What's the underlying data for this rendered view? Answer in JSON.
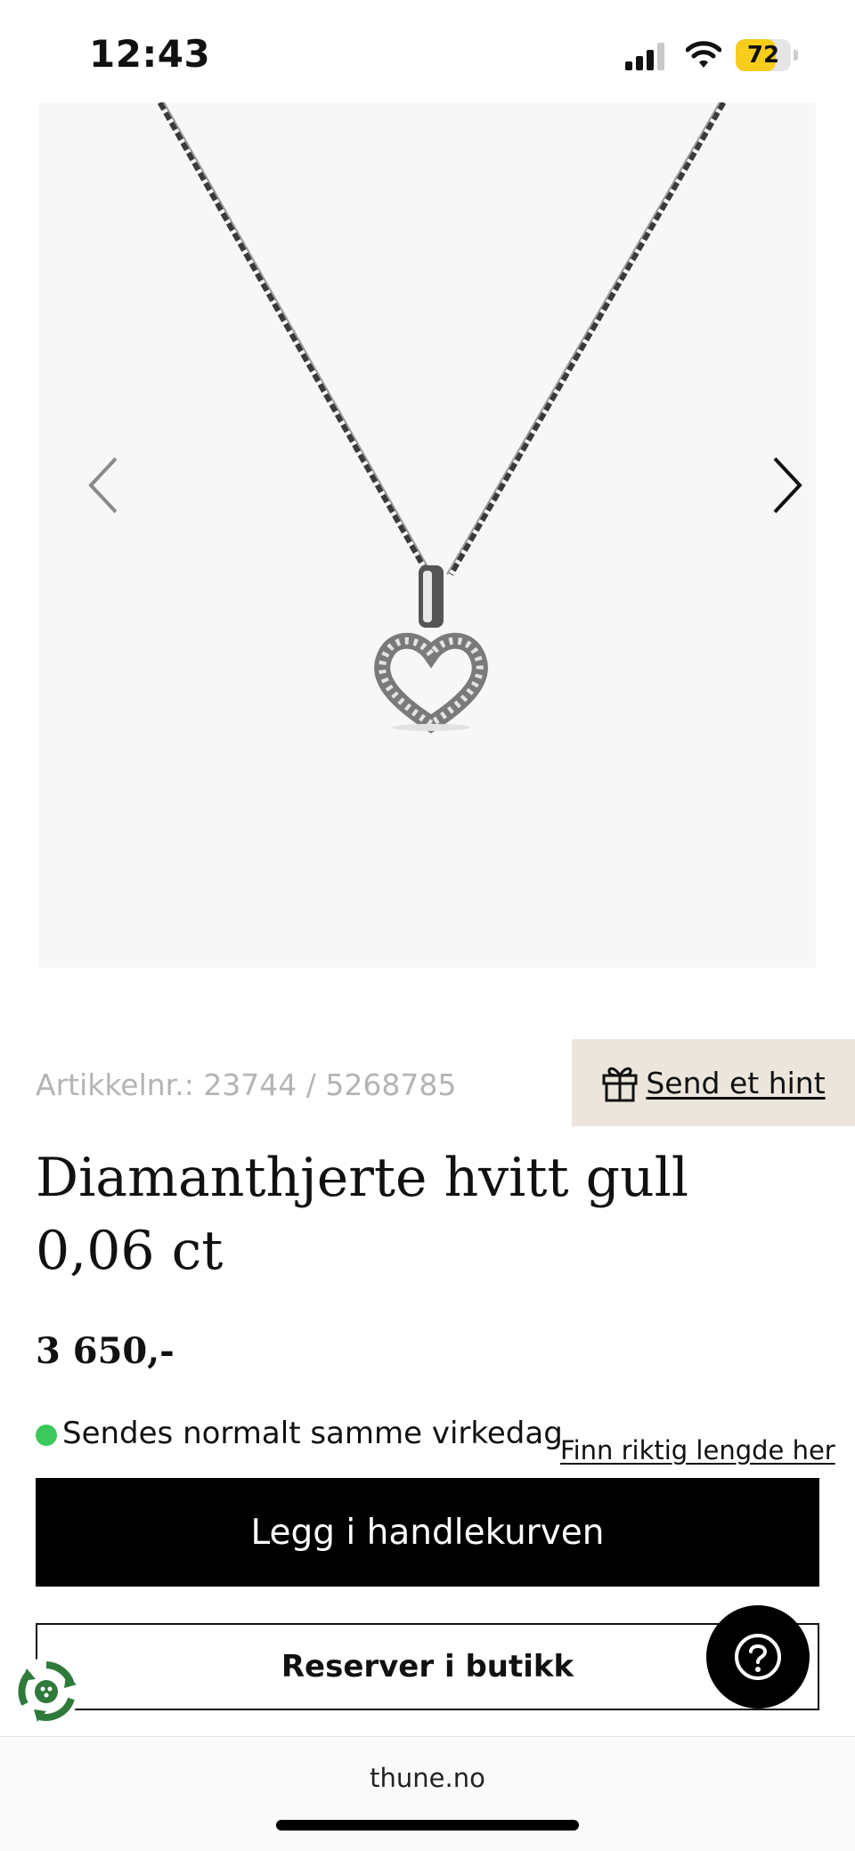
{
  "status_bar": {
    "time": "12:43",
    "battery_level": "72",
    "battery_fraction": 0.72,
    "icons": [
      "cellular-signal-icon",
      "wifi-icon",
      "battery-icon"
    ],
    "battery_color": "#f6cd1a"
  },
  "product": {
    "image_alt": "Heart pendant necklace in white gold with diamonds",
    "sku": "Artikkelnr.: 23744 / 5268785",
    "hint_label": "Send et hint",
    "title": "Diamanthjerte hvitt gull 0,06 ct",
    "price": "3 650,-",
    "stock_text": "Sendes normalt samme virkedag",
    "stock_color": "#3ac95a",
    "length_link": "Finn riktig lengde her",
    "add_to_cart": "Legg i handlekurven",
    "reserve": "Reserver i butikk"
  },
  "browser": {
    "url": "thune.no"
  },
  "colors": {
    "hint_bg": "#ebe5dc",
    "primary": "#000000",
    "eco_green": "#2f7a3b"
  }
}
